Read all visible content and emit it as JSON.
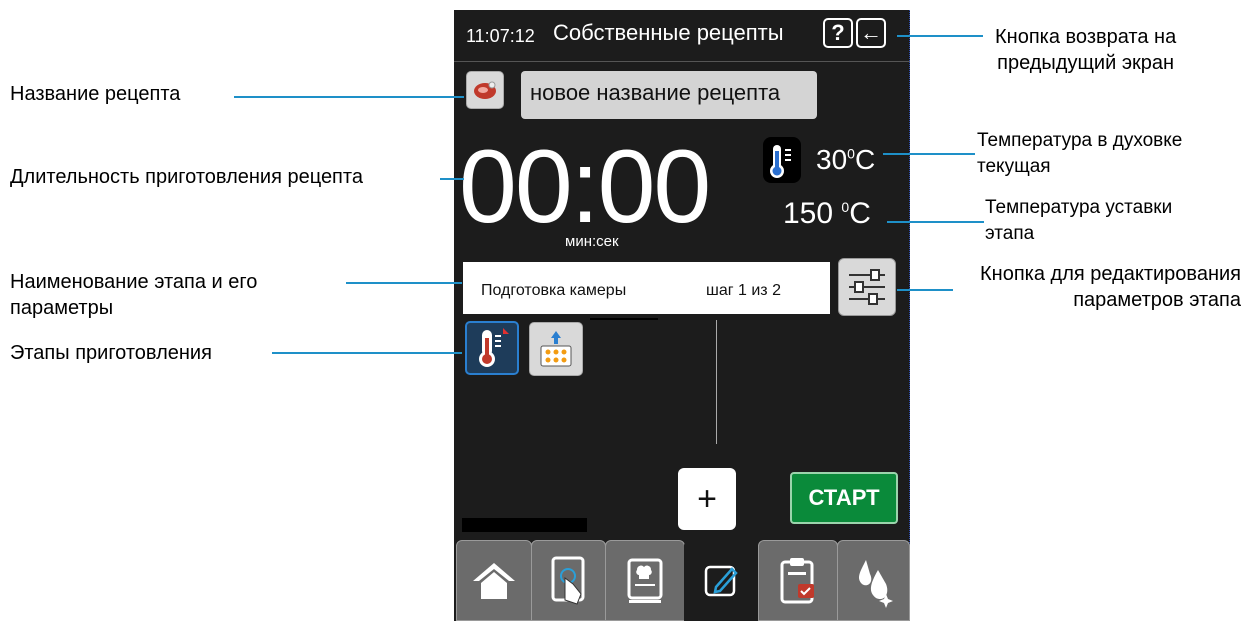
{
  "header": {
    "time": "11:07:12",
    "title": "Собственные рецепты",
    "help_label": "?",
    "back_label": "←"
  },
  "recipe": {
    "name": "новое название рецепта"
  },
  "timer": {
    "value": "00:00",
    "unit": "мин:сек"
  },
  "temperatures": {
    "current": "30",
    "set": "150",
    "current_unit": "C",
    "set_unit": "C",
    "degree": "0"
  },
  "stage": {
    "name": "Подготовка камеры",
    "step": "шаг 1 из 2"
  },
  "buttons": {
    "add_label": "+",
    "start_label": "СТАРТ"
  },
  "callouts": {
    "recipe_name": "Название рецепта",
    "duration": "Длительность приготовления рецепта",
    "stage_name_line1": "Наименование этапа и его",
    "stage_name_line2": "параметры",
    "stages": "Этапы приготовления",
    "back_line1": "Кнопка возврата на",
    "back_line2": "предыдущий экран",
    "oven_temp_line1": "Температура в духовке",
    "oven_temp_line2": "текущая",
    "set_temp_line1": "Температура уставки",
    "set_temp_line2": "этапа",
    "edit_line1": "Кнопка для редактирования",
    "edit_line2": "параметров этапа"
  },
  "tabs": [
    {
      "icon": "home-icon"
    },
    {
      "icon": "touch-tablet-icon"
    },
    {
      "icon": "cookbook-icon"
    },
    {
      "icon": "edit-icon"
    },
    {
      "icon": "clipboard-icon"
    },
    {
      "icon": "cleaning-icon"
    }
  ],
  "colors": {
    "device_bg": "#1c1c1c",
    "accent_line": "#1e90c8",
    "start_green": "#0a8a3a",
    "tab_gray": "#6b6b6b",
    "stage_selected_border": "#2a7fd0"
  }
}
